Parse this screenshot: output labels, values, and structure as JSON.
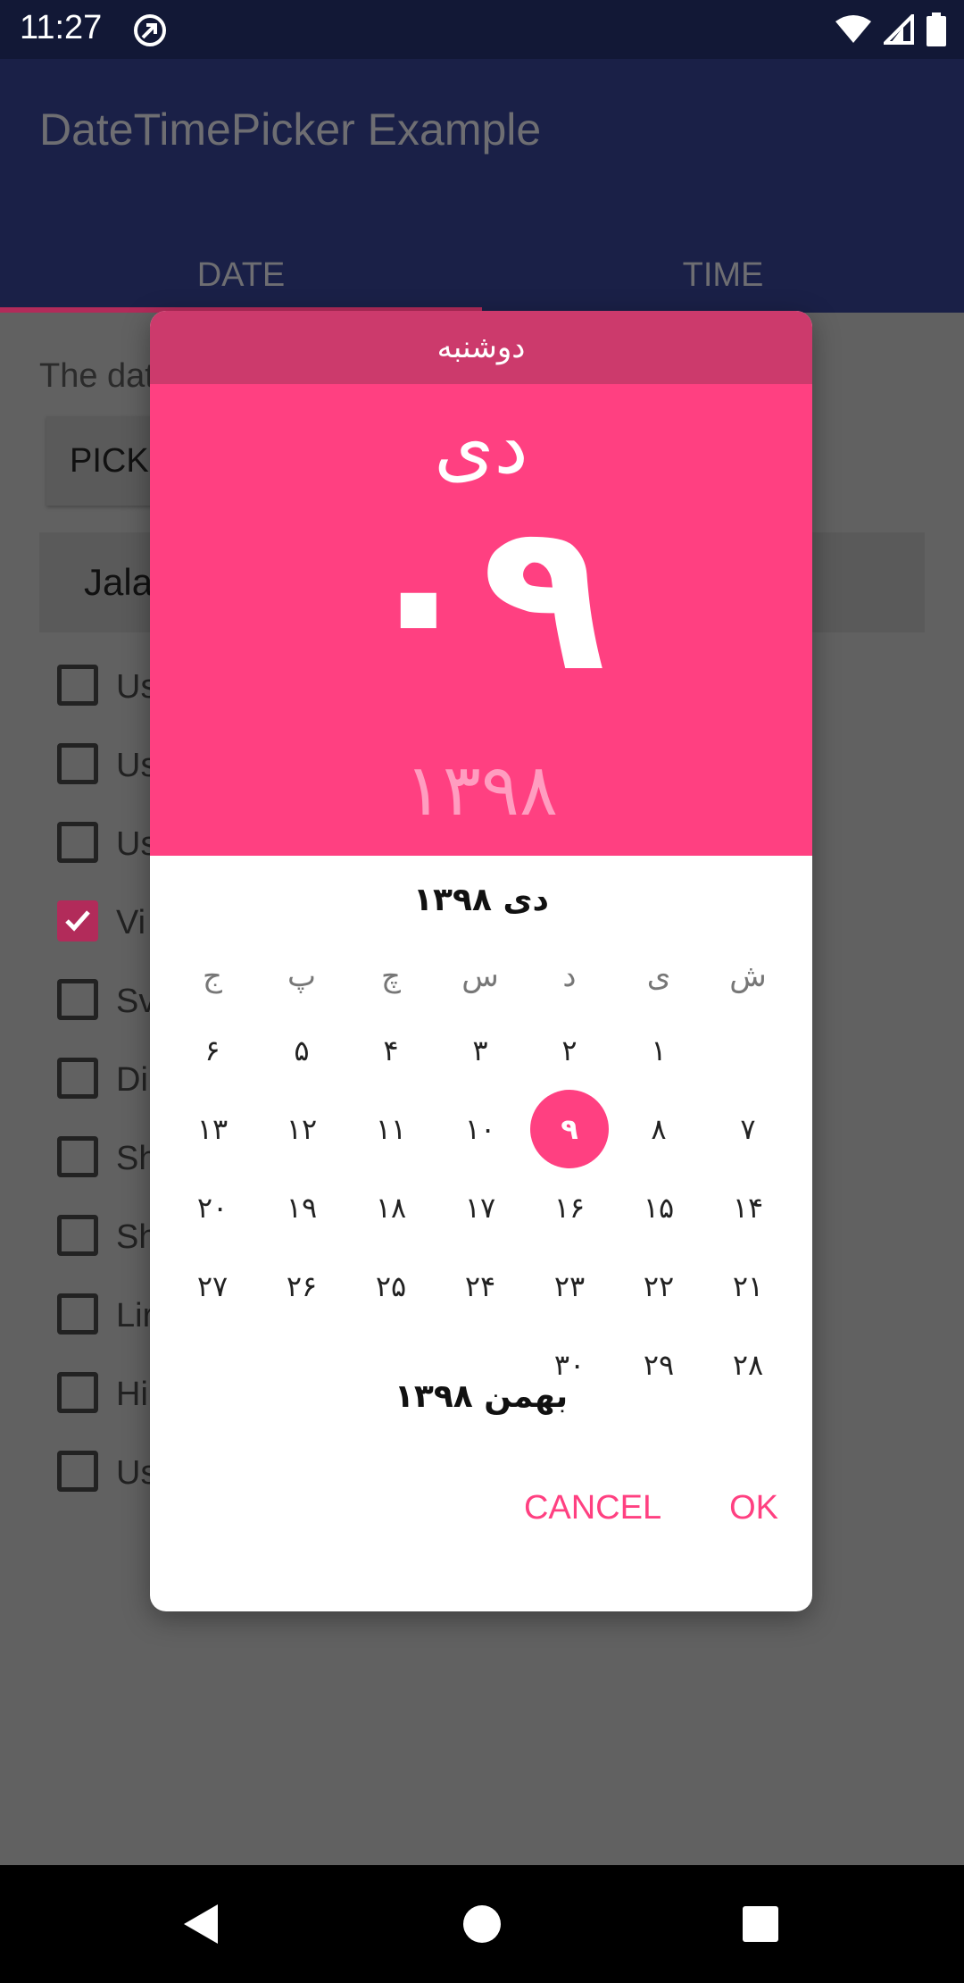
{
  "status_bar": {
    "time": "11:27",
    "icons": [
      "app-notification-icon",
      "wifi-icon",
      "signal-icon",
      "battery-icon"
    ]
  },
  "app_bar": {
    "title": "DateTimePicker Example",
    "tabs": [
      {
        "label": "DATE"
      },
      {
        "label": "TIME"
      }
    ]
  },
  "background": {
    "label": "The dat",
    "pick_button": "PICK",
    "spinner_value": "Jala",
    "checkboxes": [
      {
        "label": "Us",
        "checked": false
      },
      {
        "label": "Us",
        "checked": false
      },
      {
        "label": "Us",
        "checked": false
      },
      {
        "label": "Vi",
        "checked": true
      },
      {
        "label": "Sv",
        "checked": false
      },
      {
        "label": "Di",
        "checked": false
      },
      {
        "label": "Sh",
        "checked": false
      },
      {
        "label": "Sh",
        "checked": false
      },
      {
        "label": "Lir",
        "checked": false
      },
      {
        "label": "Hi",
        "checked": false
      },
      {
        "label": "Us",
        "checked": false
      }
    ]
  },
  "dialog": {
    "weekday": "دوشنبه",
    "month": "دی",
    "day": "۰۹",
    "year": "۱۳۹۸",
    "calendar_title": "دی ۱۳۹۸",
    "weekday_headers": [
      "ش",
      "ی",
      "د",
      "س",
      "چ",
      "پ",
      "ج"
    ],
    "weeks": [
      [
        "",
        "۱",
        "۲",
        "۳",
        "۴",
        "۵",
        "۶"
      ],
      [
        "۷",
        "۸",
        "۹",
        "۱۰",
        "۱۱",
        "۱۲",
        "۱۳"
      ],
      [
        "۱۴",
        "۱۵",
        "۱۶",
        "۱۷",
        "۱۸",
        "۱۹",
        "۲۰"
      ],
      [
        "۲۱",
        "۲۲",
        "۲۳",
        "۲۴",
        "۲۵",
        "۲۶",
        "۲۷"
      ],
      [
        "۲۸",
        "۲۹",
        "۳۰",
        "",
        "",
        "",
        ""
      ]
    ],
    "selected_day": "۹",
    "next_month_title": "بهمن ۱۳۹۸",
    "cancel_label": "CANCEL",
    "ok_label": "OK"
  },
  "colors": {
    "accent": "#ff4081",
    "accent_dark": "#cc3a6c",
    "primary": "#1a2047",
    "scrim": "#616161"
  }
}
